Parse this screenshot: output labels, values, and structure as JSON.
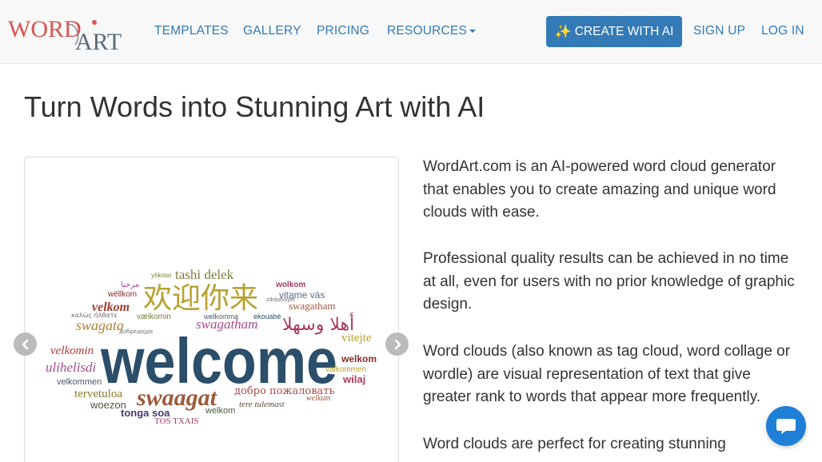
{
  "logo": {
    "part1": "WORD",
    "part2": "ART"
  },
  "nav": {
    "templates": "TEMPLATES",
    "gallery": "GALLERY",
    "pricing": "PRICING",
    "resources": "RESOURCES",
    "create_ai": "CREATE WITH AI",
    "signup": "SIGN UP",
    "login": "LOG IN"
  },
  "title": "Turn Words into Stunning Art with AI",
  "paragraphs": [
    "WordArt.com is an AI-powered word cloud generator that enables you to create amazing and unique word clouds with ease.",
    "Professional quality results can be achieved in no time at all, even for users with no prior knowledge of graphic design.",
    "Word clouds (also known as tag cloud, word collage or wordle) are visual representation of text that give greater rank to words that appear more frequently.",
    "Word clouds are perfect for creating stunning"
  ],
  "cloud": {
    "main": "welcome",
    "swaagat": "swaagat",
    "chinese": "欢迎你来",
    "arabic": "أهلا وسهلا",
    "tashi": "tashi delek",
    "velkom": "velkom",
    "swagata": "swagata",
    "swagatham": "swagatham",
    "velkomin": "velkomin",
    "ulihelisdi": "ulihelisdi",
    "tervetuloa": "tervetuloa",
    "woezon": "woezon",
    "tonga": "tonga soa",
    "dobro": "добро пожаловать",
    "vitejte": "vitejte",
    "welkom": "welkom",
    "wilaj": "wilaj",
    "vitame": "vitame vás",
    "swagatham2": "swagatham",
    "velkommen": "velkommen",
    "tere": "tere tulemast",
    "welkum": "welkum",
    "tos": "TOS TXAIS",
    "valkommen": "valkommen",
    "vaelkomin": "vælkomin",
    "wellkom": "wëllkom",
    "marhaba": "مرحبا",
    "wolkom": "wolkom",
    "welkom2": "welkom",
    "welkomma": "welkomma",
    "ekouabe": "ekouabé",
    "yokoso": "yōkoso",
    "kalos": "καλώς ήλθατε",
    "dobredojde": "добредојде",
    "zdravstvuy": "zdrástvuyte"
  }
}
